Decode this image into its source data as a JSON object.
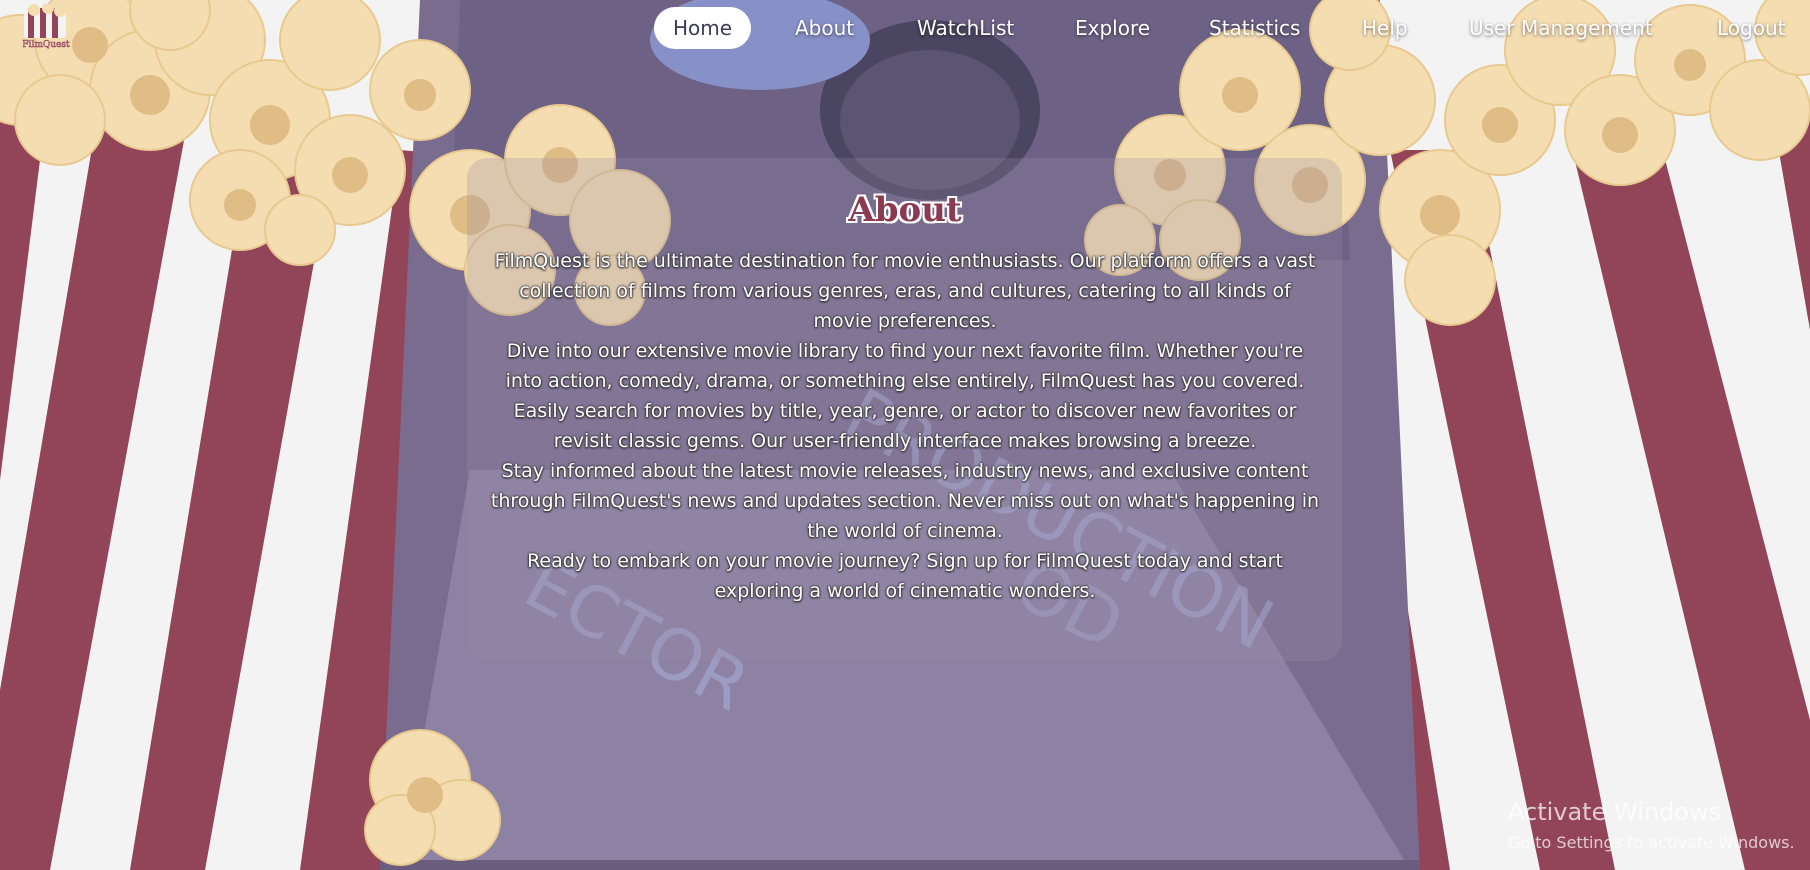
{
  "brand": {
    "name": "FilmQuest"
  },
  "nav": {
    "items": [
      {
        "label": "Home",
        "active": true
      },
      {
        "label": "About",
        "active": false
      },
      {
        "label": "WatchList",
        "active": false
      },
      {
        "label": "Explore",
        "active": false
      },
      {
        "label": "Statistics",
        "active": false
      },
      {
        "label": "Help",
        "active": false
      },
      {
        "label": "User Management",
        "active": false
      },
      {
        "label": "Logout",
        "active": false
      }
    ]
  },
  "about": {
    "title": "About",
    "paragraphs": [
      "FilmQuest is the ultimate destination for movie enthusiasts. Our platform offers a vast collection of films from various genres, eras, and cultures, catering to all kinds of movie preferences.",
      "Dive into our extensive movie library to find your next favorite film. Whether you're into action, comedy, drama, or something else entirely, FilmQuest has you covered.",
      "Easily search for movies by title, year, genre, or actor to discover new favorites or revisit classic gems. Our user-friendly interface makes browsing a breeze.",
      "Stay informed about the latest movie releases, industry news, and exclusive content through FilmQuest's news and updates section. Never miss out on what's happening in the world of cinema.",
      "Ready to embark on your movie journey? Sign up for FilmQuest today and start exploring a world of cinematic wonders."
    ]
  },
  "watermark": {
    "title": "Activate Windows",
    "subtitle": "Go to Settings to activate Windows."
  },
  "colors": {
    "stripe_red": "#924459",
    "stripe_white": "#f3f3f3",
    "popcorn": "#f5ddb2",
    "popcorn_shade": "#ddbb80",
    "accent_title": "#8a3a52"
  }
}
